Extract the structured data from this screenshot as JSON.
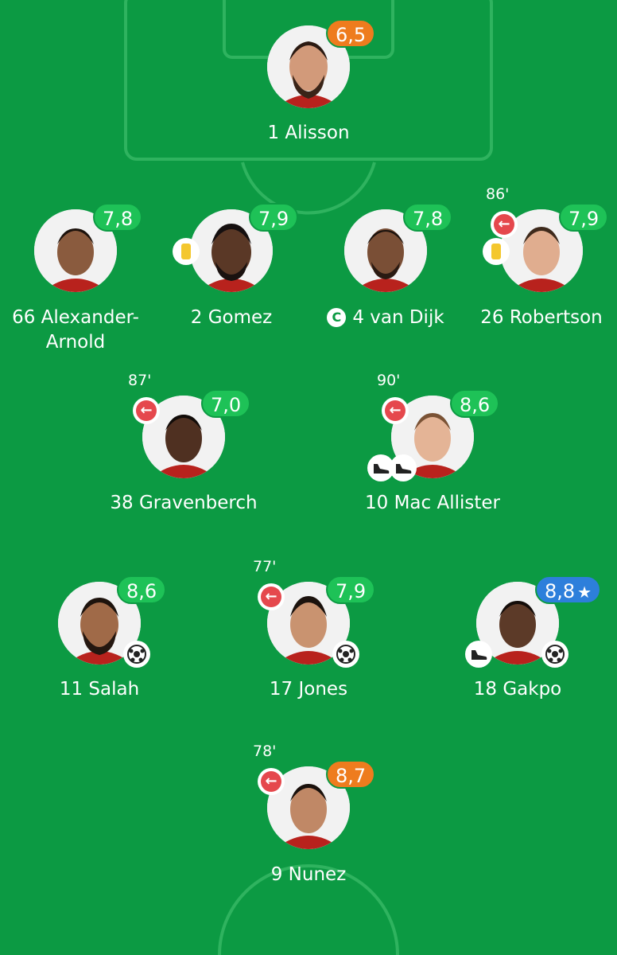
{
  "colors": {
    "pitch": "#0c9a43",
    "pitch_lines": "#2fb35f",
    "rating_green": "#1ec257",
    "rating_orange": "#ee7c1e",
    "rating_blue": "#2d7fdb",
    "sub_icon": "#e5484d",
    "yellow_card": "#f4c72e"
  },
  "players": [
    {
      "id": "alisson",
      "label": "1 Alisson",
      "rating": "6,5",
      "rating_color": "orange"
    },
    {
      "id": "alexander-arnold",
      "label_line1": "66 Alexander-",
      "label_line2": "Arnold",
      "rating": "7,8",
      "rating_color": "green"
    },
    {
      "id": "gomez",
      "label": "2 Gomez",
      "rating": "7,9",
      "rating_color": "green",
      "yellow_card": true
    },
    {
      "id": "van-dijk",
      "label": "4 van Dijk",
      "captain_mark": "C",
      "rating": "7,8",
      "rating_color": "green"
    },
    {
      "id": "robertson",
      "label": "26 Robertson",
      "rating": "7,9",
      "rating_color": "green",
      "yellow_card": true,
      "sub_minute": "86'",
      "sub_icon": "←"
    },
    {
      "id": "gravenberch",
      "label": "38 Gravenberch",
      "rating": "7,0",
      "rating_color": "green",
      "sub_minute": "87'",
      "sub_icon": "←"
    },
    {
      "id": "mac-allister",
      "label": "10 Mac Allister",
      "rating": "8,6",
      "rating_color": "green",
      "sub_minute": "90'",
      "sub_icon": "←",
      "icons": [
        "boot-icon",
        "boot-icon"
      ]
    },
    {
      "id": "salah",
      "label": "11 Salah",
      "rating": "8,6",
      "rating_color": "green",
      "icons": [
        "ball-icon"
      ]
    },
    {
      "id": "jones",
      "label": "17 Jones",
      "rating": "7,9",
      "rating_color": "green",
      "sub_minute": "77'",
      "sub_icon": "←",
      "icons": [
        "ball-icon"
      ]
    },
    {
      "id": "gakpo",
      "label": "18 Gakpo",
      "rating": "8,8",
      "rating_star": "★",
      "rating_color": "blue",
      "icons": [
        "boot-icon",
        "ball-icon"
      ]
    },
    {
      "id": "nunez",
      "label": "9 Nunez",
      "rating": "8,7",
      "rating_color": "orange",
      "sub_minute": "78'",
      "sub_icon": "←"
    }
  ]
}
